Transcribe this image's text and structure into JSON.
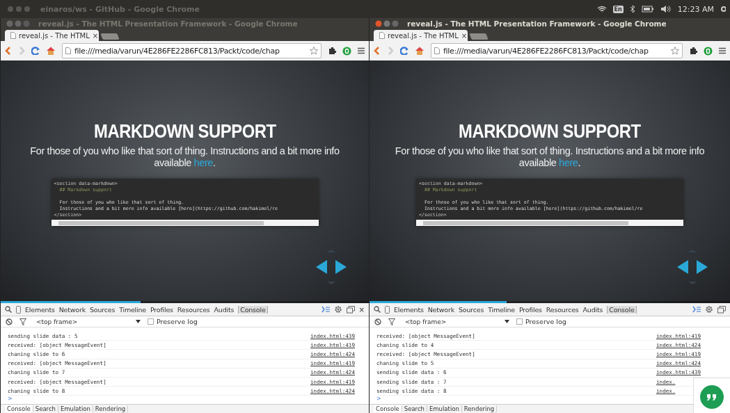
{
  "desktop_bar": {
    "background_window_title": "einaros/ws - GitHub - Google Chrome",
    "keyboard_layout": "En",
    "clock": "12:23 AM"
  },
  "windows": [
    {
      "title": "reveal.js - The HTML Presentation Framework - Google Chrome",
      "active": false,
      "tab": {
        "label": "reveal.js - The HTML",
        "close": "×"
      },
      "address": "file:///media/varun/4E286FE2286FC813/Packt/code/chap",
      "slide": {
        "heading": "MARKDOWN SUPPORT",
        "text": "For those of you who like that sort of thing. Instructions and a bit more info available ",
        "link": "here",
        "text_end": ".",
        "code": [
          {
            "kind": "tag",
            "text": "<section data-markdown>"
          },
          {
            "kind": "comment",
            "text": "  ## Markdown support"
          },
          {
            "kind": "blank"
          },
          {
            "kind": "text",
            "text": "  For those of you who like that sort of thing."
          },
          {
            "kind": "text",
            "text": "  Instructions and a bit more info available [here](https://github.com/hakimel/re"
          },
          {
            "kind": "tag",
            "text": "</section>"
          }
        ],
        "progress": {
          "level": 0.38
        }
      },
      "devtools": {
        "tabs": [
          {
            "label": "Elements",
            "selected": false
          },
          {
            "label": "Network",
            "selected": false
          },
          {
            "label": "Sources",
            "selected": false
          },
          {
            "label": "Timeline",
            "selected": false
          },
          {
            "label": "Profiles",
            "selected": false
          },
          {
            "label": "Resources",
            "selected": false
          },
          {
            "label": "Audits",
            "selected": false
          },
          {
            "label": "Console",
            "selected": true
          }
        ],
        "close": "×",
        "frame": "<top frame>",
        "preserve_log": {
          "label": "Preserve log",
          "checked": false
        },
        "messages": [
          {
            "text": "sending slide data : 5",
            "source": "index.html:439"
          },
          {
            "text": "received: [object MessageEvent]",
            "source": "index.html:419"
          },
          {
            "text": "chaning slide to 6",
            "source": "index.html:424"
          },
          {
            "text": "received: [object MessageEvent]",
            "source": "index.html:419"
          },
          {
            "text": "chaning slide to 7",
            "source": "index.html:424"
          },
          {
            "text": "received: [object MessageEvent]",
            "source": "index.html:419"
          },
          {
            "text": "chaning slide to 8",
            "source": "index.html:424"
          }
        ],
        "prompt": ">",
        "drawer_tabs": [
          {
            "label": "Console",
            "selected": true
          },
          {
            "label": "Search",
            "selected": false
          },
          {
            "label": "Emulation",
            "selected": false
          },
          {
            "label": "Rendering",
            "selected": false
          }
        ]
      }
    },
    {
      "title": "reveal.js - The HTML Presentation Framework - Google Chrome",
      "active": true,
      "tab": {
        "label": "reveal.js - The HTML",
        "close": "×"
      },
      "address": "file:///media/varun/4E286FE2286FC813/Packt/code/chap",
      "slide": {
        "heading": "MARKDOWN SUPPORT",
        "text": "For those of you who like that sort of thing. Instructions and a bit more info available ",
        "link": "here",
        "text_end": ".",
        "code": [
          {
            "kind": "tag",
            "text": "<section data-markdown>"
          },
          {
            "kind": "comment",
            "text": "  ## Markdown support"
          },
          {
            "kind": "blank"
          },
          {
            "kind": "text",
            "text": "  For those of you who like that sort of thing."
          },
          {
            "kind": "text",
            "text": "  Instructions and a bit more info available [here](https://github.com/hakimel/re"
          },
          {
            "kind": "tag",
            "text": "</section>"
          }
        ],
        "progress": {
          "level": 0.38
        }
      },
      "devtools": {
        "tabs": [
          {
            "label": "Elements",
            "selected": false
          },
          {
            "label": "Network",
            "selected": false
          },
          {
            "label": "Sources",
            "selected": false
          },
          {
            "label": "Timeline",
            "selected": false
          },
          {
            "label": "Profiles",
            "selected": false
          },
          {
            "label": "Resources",
            "selected": false
          },
          {
            "label": "Audits",
            "selected": false
          },
          {
            "label": "Console",
            "selected": true
          }
        ],
        "frame": "<top frame>",
        "preserve_log": {
          "label": "Preserve log",
          "checked": false
        },
        "messages": [
          {
            "text": "received: [object MessageEvent]",
            "source": "index.html:419"
          },
          {
            "text": "chaning slide to 4",
            "source": "index.html:424"
          },
          {
            "text": "received: [object MessageEvent]",
            "source": "index.html:419"
          },
          {
            "text": "chaning slide to 5",
            "source": "index.html:424"
          },
          {
            "text": "sending slide data : 6",
            "source": "index.html:439"
          },
          {
            "text": "sending slide data : 7",
            "source": "index."
          },
          {
            "text": "sending slide data : 8",
            "source": "index."
          }
        ],
        "prompt": ">",
        "drawer_tabs": [
          {
            "label": "Console",
            "selected": true
          },
          {
            "label": "Search",
            "selected": false
          },
          {
            "label": "Emulation",
            "selected": false
          },
          {
            "label": "Rendering",
            "selected": false
          }
        ]
      },
      "hangouts_bubble": true
    }
  ]
}
